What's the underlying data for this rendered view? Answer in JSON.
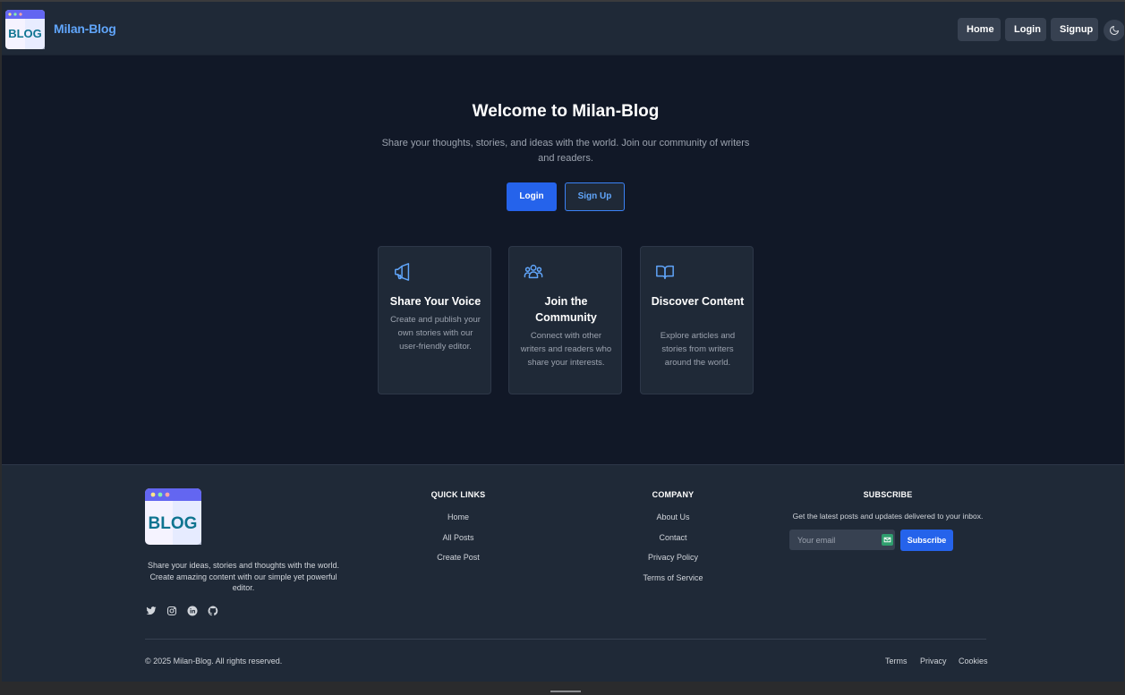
{
  "navbar": {
    "logo_text": "BLOG",
    "brand": "Milan-Blog",
    "home": "Home",
    "login": "Login",
    "signup": "Signup",
    "theme_icon": "moon-icon"
  },
  "hero": {
    "title": "Welcome to Milan-Blog",
    "subtitle": "Share your thoughts, stories, and ideas with the world. Join our community of writers and readers.",
    "login": "Login",
    "signup": "Sign Up"
  },
  "features": [
    {
      "icon": "megaphone-icon",
      "title": "Share Your Voice",
      "desc": "Create and publish your own stories with our user-friendly editor."
    },
    {
      "icon": "users-icon",
      "title": "Join the Community",
      "desc": "Connect with other writers and readers who share your interests."
    },
    {
      "icon": "book-icon",
      "title": "Discover Content",
      "desc": "Explore articles and stories from writers around the world."
    }
  ],
  "footer": {
    "logo_text": "BLOG",
    "description": "Share your ideas, stories and thoughts with the world. Create amazing content with our simple yet powerful editor.",
    "socials": [
      "twitter-icon",
      "instagram-icon",
      "linkedin-icon",
      "github-icon"
    ],
    "quick_links": {
      "title": "QUICK LINKS",
      "items": [
        "Home",
        "All Posts",
        "Create Post"
      ]
    },
    "company": {
      "title": "COMPANY",
      "items": [
        "About Us",
        "Contact",
        "Privacy Policy",
        "Terms of Service"
      ]
    },
    "subscribe": {
      "title": "SUBSCRIBE",
      "text": "Get the latest posts and updates delivered to your inbox.",
      "placeholder": "Your email",
      "button": "Subscribe"
    },
    "copyright": "© 2025 Milan-Blog. All rights reserved.",
    "legal": [
      "Terms",
      "Privacy",
      "Cookies"
    ]
  },
  "colors": {
    "accent": "#2563eb",
    "brand": "#60a5fa",
    "background": "#111827",
    "surface": "#1f2937"
  }
}
